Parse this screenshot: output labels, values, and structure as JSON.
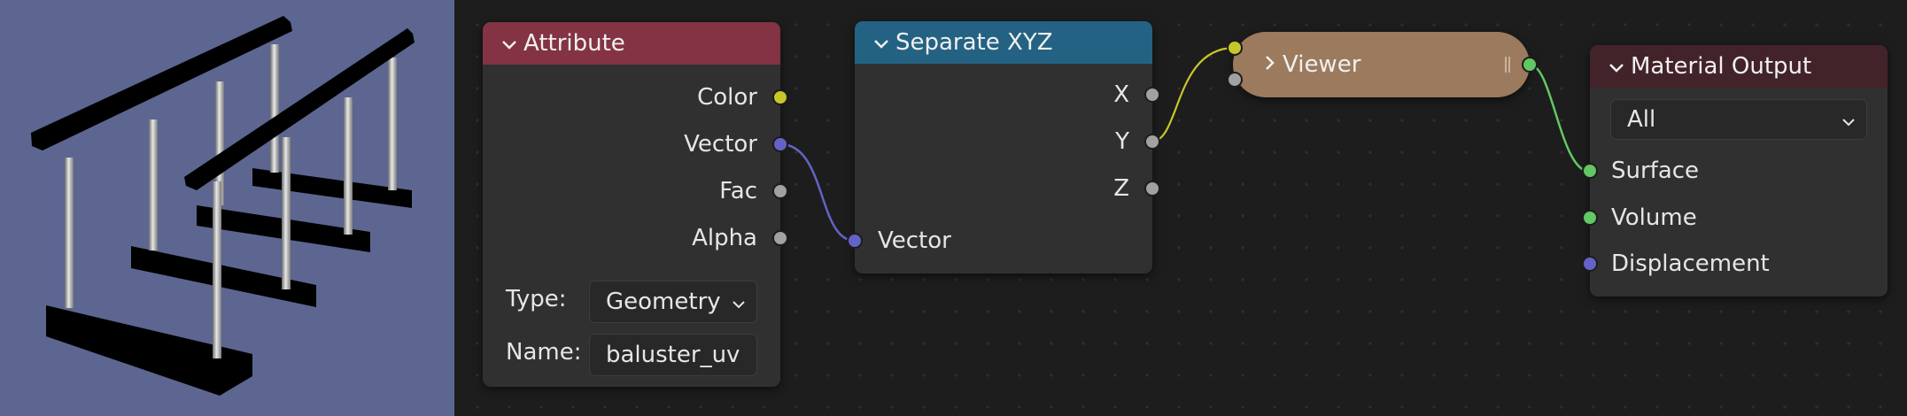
{
  "nodes": {
    "attribute": {
      "title": "Attribute",
      "outputs": [
        "Color",
        "Vector",
        "Fac",
        "Alpha"
      ],
      "type_label": "Type:",
      "type_value": "Geometry",
      "name_label": "Name:",
      "name_value": "baluster_uv",
      "header_color": "#833344"
    },
    "separate_xyz": {
      "title": "Separate XYZ",
      "outputs": [
        "X",
        "Y",
        "Z"
      ],
      "input": "Vector",
      "header_color": "#246283"
    },
    "viewer": {
      "title": "Viewer",
      "header_color": "#9c7a5d"
    },
    "material_output": {
      "title": "Material Output",
      "target_value": "All",
      "inputs": [
        "Surface",
        "Volume",
        "Displacement"
      ],
      "header_color": "#43232a"
    }
  },
  "colors": {
    "viewport_bg": "#5c6690",
    "editor_bg": "#1d1d1d",
    "socket_color": "#c7c729",
    "socket_vector": "#6363c7",
    "socket_float": "#a1a1a1",
    "socket_shader": "#63c763"
  }
}
